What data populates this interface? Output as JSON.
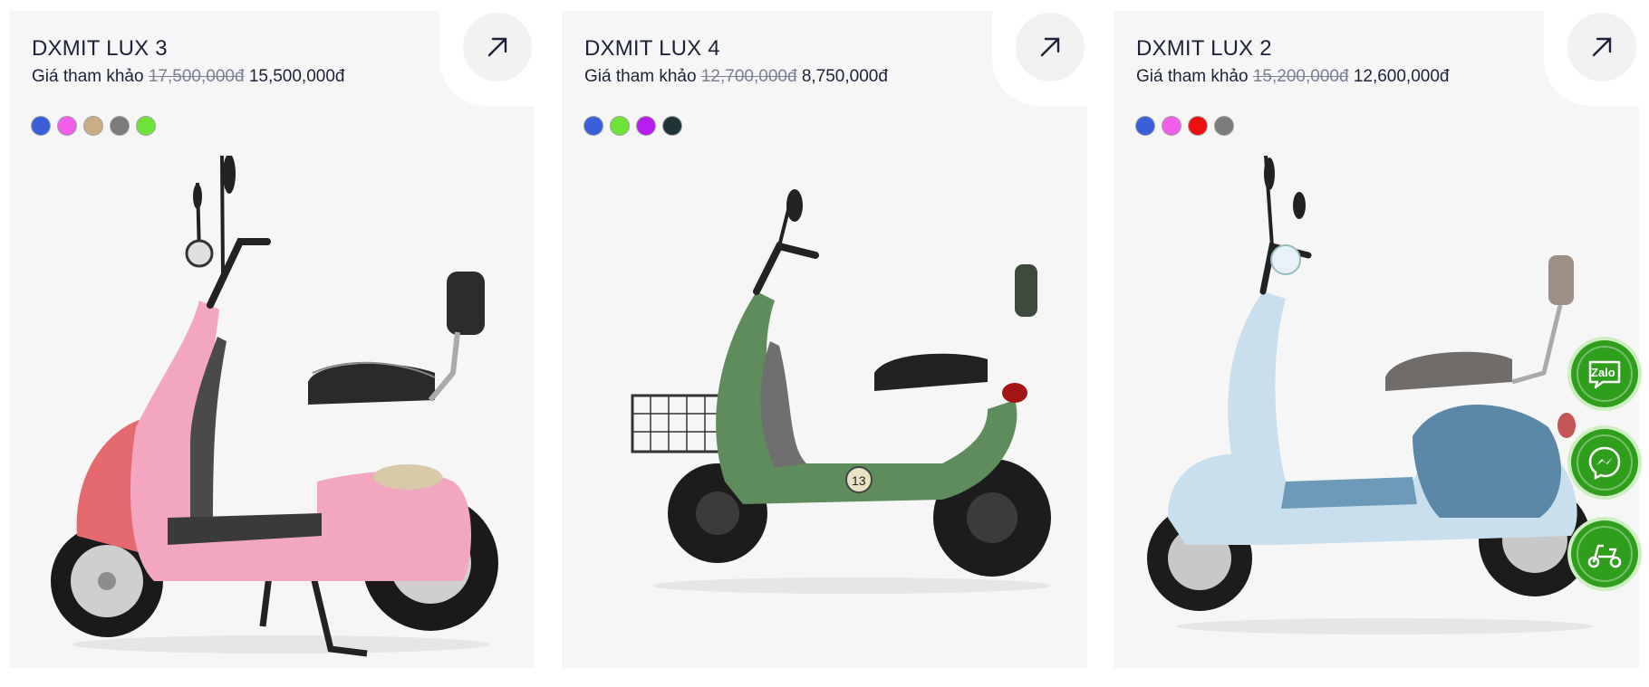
{
  "products": [
    {
      "name": "DXMIT LUX 3",
      "price_label": "Giá tham khảo",
      "old_price": "17,500,000đ",
      "price": "15,500,000đ",
      "colors": [
        "#3a5fd8",
        "#f15ee9",
        "#c9ad85",
        "#7c7c7c",
        "#6ee43a"
      ],
      "image": "pink-scooter"
    },
    {
      "name": "DXMIT LUX 4",
      "price_label": "Giá tham khảo",
      "old_price": "12,700,000đ",
      "price": "8,750,000đ",
      "colors": [
        "#3a5fd8",
        "#6ee43a",
        "#b71df0",
        "#1f3434"
      ],
      "image": "green-scooter"
    },
    {
      "name": "DXMIT LUX 2",
      "price_label": "Giá tham khảo",
      "old_price": "15,200,000đ",
      "price": "12,600,000đ",
      "colors": [
        "#3a5fd8",
        "#f15ee9",
        "#ee1010",
        "#7c7c7c"
      ],
      "image": "blue-scooter"
    }
  ],
  "floating_contacts": {
    "zalo_label": "Zalo",
    "icons": [
      "zalo-icon",
      "messenger-icon",
      "scooter-icon"
    ]
  },
  "accent": "#2f9e1c"
}
